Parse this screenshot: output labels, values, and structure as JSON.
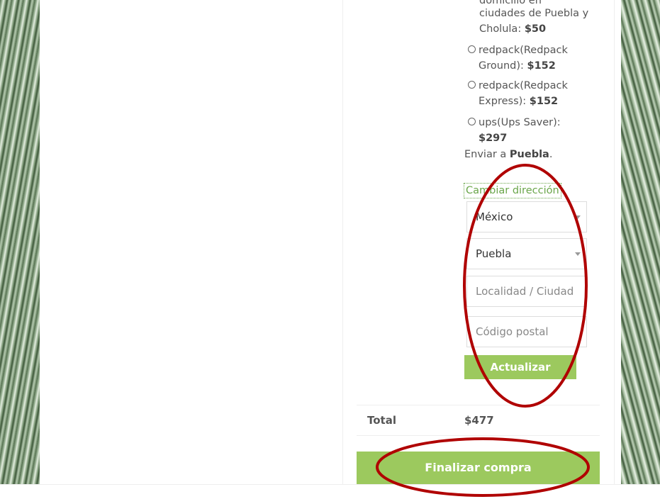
{
  "shipping_options": {
    "top_partial": "domicilio en",
    "first": {
      "label": "ciudades de Puebla y Cholula:",
      "price": "$50"
    },
    "options": [
      {
        "label": "redpack(Redpack Ground):",
        "price": "$152"
      },
      {
        "label": "redpack(Redpack Express):",
        "price": "$152"
      },
      {
        "label": "ups(Ups Saver):",
        "price": "$297"
      }
    ]
  },
  "send_to": {
    "prefix": "Enviar a",
    "place": "Puebla",
    "suffix": "."
  },
  "change_address_label": "Cambiar dirección",
  "form": {
    "country": "México",
    "state": "Puebla",
    "city_placeholder": "Localidad / Ciudad",
    "postal_placeholder": "Código postal",
    "update_label": "Actualizar"
  },
  "totals": {
    "label": "Total",
    "value": "$477"
  },
  "checkout_label": "Finalizar compra",
  "annotation_color": "#b00000"
}
